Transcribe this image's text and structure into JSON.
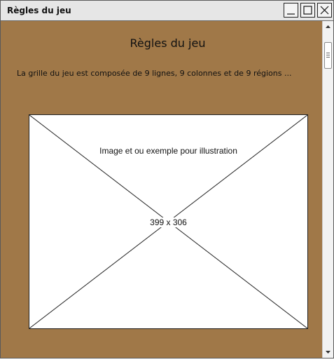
{
  "window": {
    "title": "Règles du jeu",
    "controls": {
      "minimize_icon": "minimize-icon",
      "maximize_icon": "maximize-icon",
      "close_icon": "close-icon"
    }
  },
  "page": {
    "heading": "Règles du jeu",
    "paragraph": "La grille du jeu est composée de 9 lignes, 9 colonnes et de 9 régions ...",
    "image_placeholder": {
      "caption": "Image et ou exemple pour illustration",
      "size_label": "399 x 306"
    }
  },
  "scrollbar": {
    "up_icon": "scroll-up-arrow-icon",
    "down_icon": "scroll-down-arrow-icon"
  },
  "colors": {
    "background": "#a07848",
    "titlebar": "#e6e6e6"
  }
}
